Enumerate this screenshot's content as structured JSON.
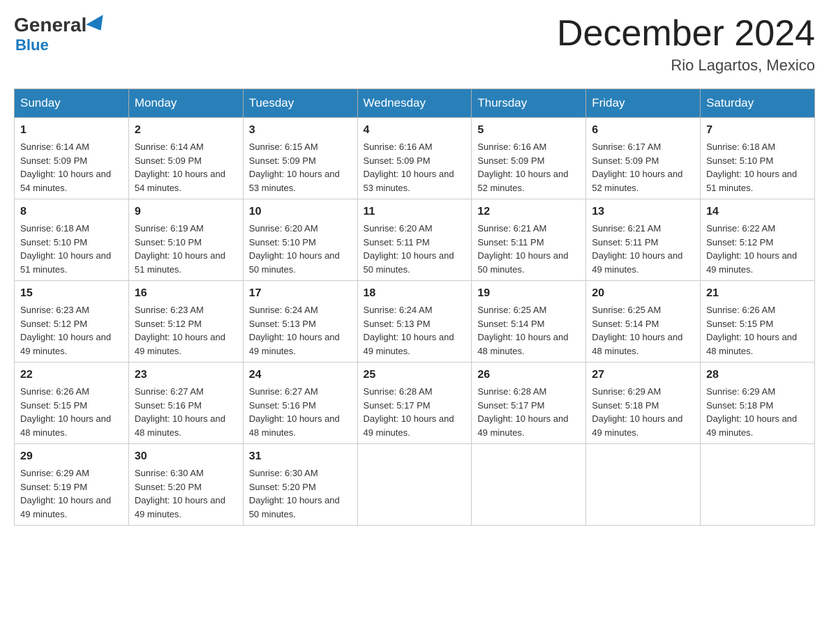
{
  "header": {
    "logo_general": "General",
    "logo_blue": "Blue",
    "month_title": "December 2024",
    "location": "Rio Lagartos, Mexico"
  },
  "weekdays": [
    "Sunday",
    "Monday",
    "Tuesday",
    "Wednesday",
    "Thursday",
    "Friday",
    "Saturday"
  ],
  "weeks": [
    [
      {
        "day": "1",
        "sunrise": "6:14 AM",
        "sunset": "5:09 PM",
        "daylight": "10 hours and 54 minutes."
      },
      {
        "day": "2",
        "sunrise": "6:14 AM",
        "sunset": "5:09 PM",
        "daylight": "10 hours and 54 minutes."
      },
      {
        "day": "3",
        "sunrise": "6:15 AM",
        "sunset": "5:09 PM",
        "daylight": "10 hours and 53 minutes."
      },
      {
        "day": "4",
        "sunrise": "6:16 AM",
        "sunset": "5:09 PM",
        "daylight": "10 hours and 53 minutes."
      },
      {
        "day": "5",
        "sunrise": "6:16 AM",
        "sunset": "5:09 PM",
        "daylight": "10 hours and 52 minutes."
      },
      {
        "day": "6",
        "sunrise": "6:17 AM",
        "sunset": "5:09 PM",
        "daylight": "10 hours and 52 minutes."
      },
      {
        "day": "7",
        "sunrise": "6:18 AM",
        "sunset": "5:10 PM",
        "daylight": "10 hours and 51 minutes."
      }
    ],
    [
      {
        "day": "8",
        "sunrise": "6:18 AM",
        "sunset": "5:10 PM",
        "daylight": "10 hours and 51 minutes."
      },
      {
        "day": "9",
        "sunrise": "6:19 AM",
        "sunset": "5:10 PM",
        "daylight": "10 hours and 51 minutes."
      },
      {
        "day": "10",
        "sunrise": "6:20 AM",
        "sunset": "5:10 PM",
        "daylight": "10 hours and 50 minutes."
      },
      {
        "day": "11",
        "sunrise": "6:20 AM",
        "sunset": "5:11 PM",
        "daylight": "10 hours and 50 minutes."
      },
      {
        "day": "12",
        "sunrise": "6:21 AM",
        "sunset": "5:11 PM",
        "daylight": "10 hours and 50 minutes."
      },
      {
        "day": "13",
        "sunrise": "6:21 AM",
        "sunset": "5:11 PM",
        "daylight": "10 hours and 49 minutes."
      },
      {
        "day": "14",
        "sunrise": "6:22 AM",
        "sunset": "5:12 PM",
        "daylight": "10 hours and 49 minutes."
      }
    ],
    [
      {
        "day": "15",
        "sunrise": "6:23 AM",
        "sunset": "5:12 PM",
        "daylight": "10 hours and 49 minutes."
      },
      {
        "day": "16",
        "sunrise": "6:23 AM",
        "sunset": "5:12 PM",
        "daylight": "10 hours and 49 minutes."
      },
      {
        "day": "17",
        "sunrise": "6:24 AM",
        "sunset": "5:13 PM",
        "daylight": "10 hours and 49 minutes."
      },
      {
        "day": "18",
        "sunrise": "6:24 AM",
        "sunset": "5:13 PM",
        "daylight": "10 hours and 49 minutes."
      },
      {
        "day": "19",
        "sunrise": "6:25 AM",
        "sunset": "5:14 PM",
        "daylight": "10 hours and 48 minutes."
      },
      {
        "day": "20",
        "sunrise": "6:25 AM",
        "sunset": "5:14 PM",
        "daylight": "10 hours and 48 minutes."
      },
      {
        "day": "21",
        "sunrise": "6:26 AM",
        "sunset": "5:15 PM",
        "daylight": "10 hours and 48 minutes."
      }
    ],
    [
      {
        "day": "22",
        "sunrise": "6:26 AM",
        "sunset": "5:15 PM",
        "daylight": "10 hours and 48 minutes."
      },
      {
        "day": "23",
        "sunrise": "6:27 AM",
        "sunset": "5:16 PM",
        "daylight": "10 hours and 48 minutes."
      },
      {
        "day": "24",
        "sunrise": "6:27 AM",
        "sunset": "5:16 PM",
        "daylight": "10 hours and 48 minutes."
      },
      {
        "day": "25",
        "sunrise": "6:28 AM",
        "sunset": "5:17 PM",
        "daylight": "10 hours and 49 minutes."
      },
      {
        "day": "26",
        "sunrise": "6:28 AM",
        "sunset": "5:17 PM",
        "daylight": "10 hours and 49 minutes."
      },
      {
        "day": "27",
        "sunrise": "6:29 AM",
        "sunset": "5:18 PM",
        "daylight": "10 hours and 49 minutes."
      },
      {
        "day": "28",
        "sunrise": "6:29 AM",
        "sunset": "5:18 PM",
        "daylight": "10 hours and 49 minutes."
      }
    ],
    [
      {
        "day": "29",
        "sunrise": "6:29 AM",
        "sunset": "5:19 PM",
        "daylight": "10 hours and 49 minutes."
      },
      {
        "day": "30",
        "sunrise": "6:30 AM",
        "sunset": "5:20 PM",
        "daylight": "10 hours and 49 minutes."
      },
      {
        "day": "31",
        "sunrise": "6:30 AM",
        "sunset": "5:20 PM",
        "daylight": "10 hours and 50 minutes."
      },
      null,
      null,
      null,
      null
    ]
  ],
  "labels": {
    "sunrise_prefix": "Sunrise: ",
    "sunset_prefix": "Sunset: ",
    "daylight_prefix": "Daylight: "
  }
}
